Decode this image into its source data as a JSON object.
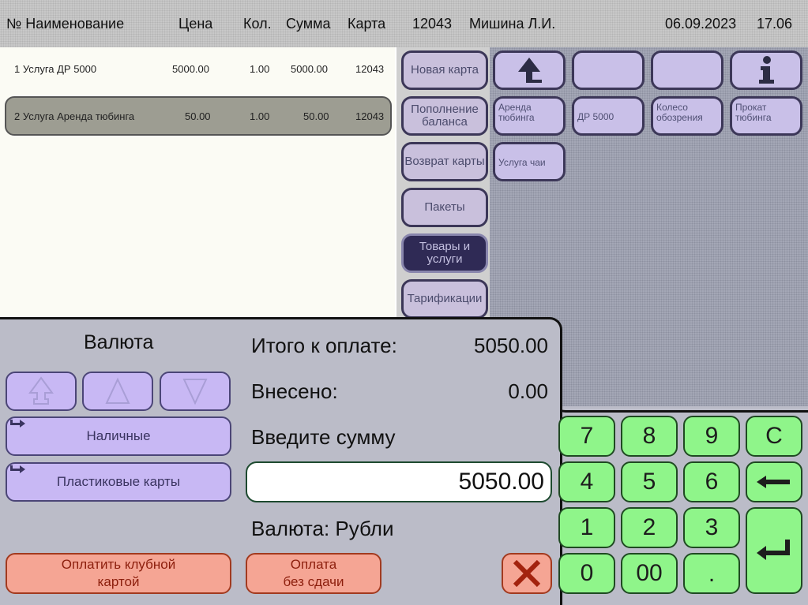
{
  "header": {
    "col_number_name": "№ Наименование",
    "col_price": "Цена",
    "col_qty": "Кол.",
    "col_sum": "Сумма",
    "col_card": "Карта",
    "card_number": "12043",
    "cashier": "Мишина Л.И.",
    "date": "06.09.2023",
    "time": "17.06"
  },
  "items": [
    {
      "num_name": "1 Услуга ДР 5000",
      "price": "5000.00",
      "qty": "1.00",
      "sum": "5000.00",
      "card": "12043",
      "selected": false
    },
    {
      "num_name": "2 Услуга Аренда тюбинга",
      "price": "50.00",
      "qty": "1.00",
      "sum": "50.00",
      "card": "12043",
      "selected": true
    }
  ],
  "categories": [
    {
      "label": "Новая карта"
    },
    {
      "label": "Пополнение баланса"
    },
    {
      "label": "Возврат карты"
    },
    {
      "label": "Пакеты"
    },
    {
      "label": "Товары и услуги"
    },
    {
      "label": "Тарификации"
    }
  ],
  "products": [
    {
      "label": "Аренда тюбинга"
    },
    {
      "label": "ДР 5000"
    },
    {
      "label": "Колесо обозрения"
    },
    {
      "label": "Прокат тюбинга"
    },
    {
      "label": "Услуга чаи"
    }
  ],
  "payment": {
    "currency_title": "Валюта",
    "cash_label": "Наличные",
    "card_label": "Пластиковые карты",
    "total_label": "Итого к оплате:",
    "total_value": "5050.00",
    "paid_label": "Внесено:",
    "paid_value": "0.00",
    "enter_sum_label": "Введите сумму",
    "input_value": "5050.00",
    "currency_label": "Валюта: Рубли",
    "club_card_line1": "Оплатить клубной",
    "club_card_line2": "картой",
    "no_change_line1": "Оплата",
    "no_change_line2": "без сдачи"
  },
  "keypad": {
    "k7": "7",
    "k8": "8",
    "k9": "9",
    "kc": "C",
    "k4": "4",
    "k5": "5",
    "k6": "6",
    "k1": "1",
    "k2": "2",
    "k3": "3",
    "k0": "0",
    "k00": "00",
    "kdot": "."
  },
  "icons": {
    "up": "arrow-up-icon",
    "info": "info-icon",
    "scroll_up": "triangle-up-icon",
    "scroll_down": "triangle-down-icon",
    "cancel": "close-icon",
    "backspace": "backspace-icon",
    "enter": "enter-icon"
  },
  "colors": {
    "header_bg": "#c8c8c8",
    "category_button": "#c9c0dc",
    "category_active": "#2f2a55",
    "payment_button": "#c8b8f4",
    "action_button": "#f5a594",
    "keypad_button": "#8ff58a",
    "panel_bg": "#bbbcc8"
  }
}
